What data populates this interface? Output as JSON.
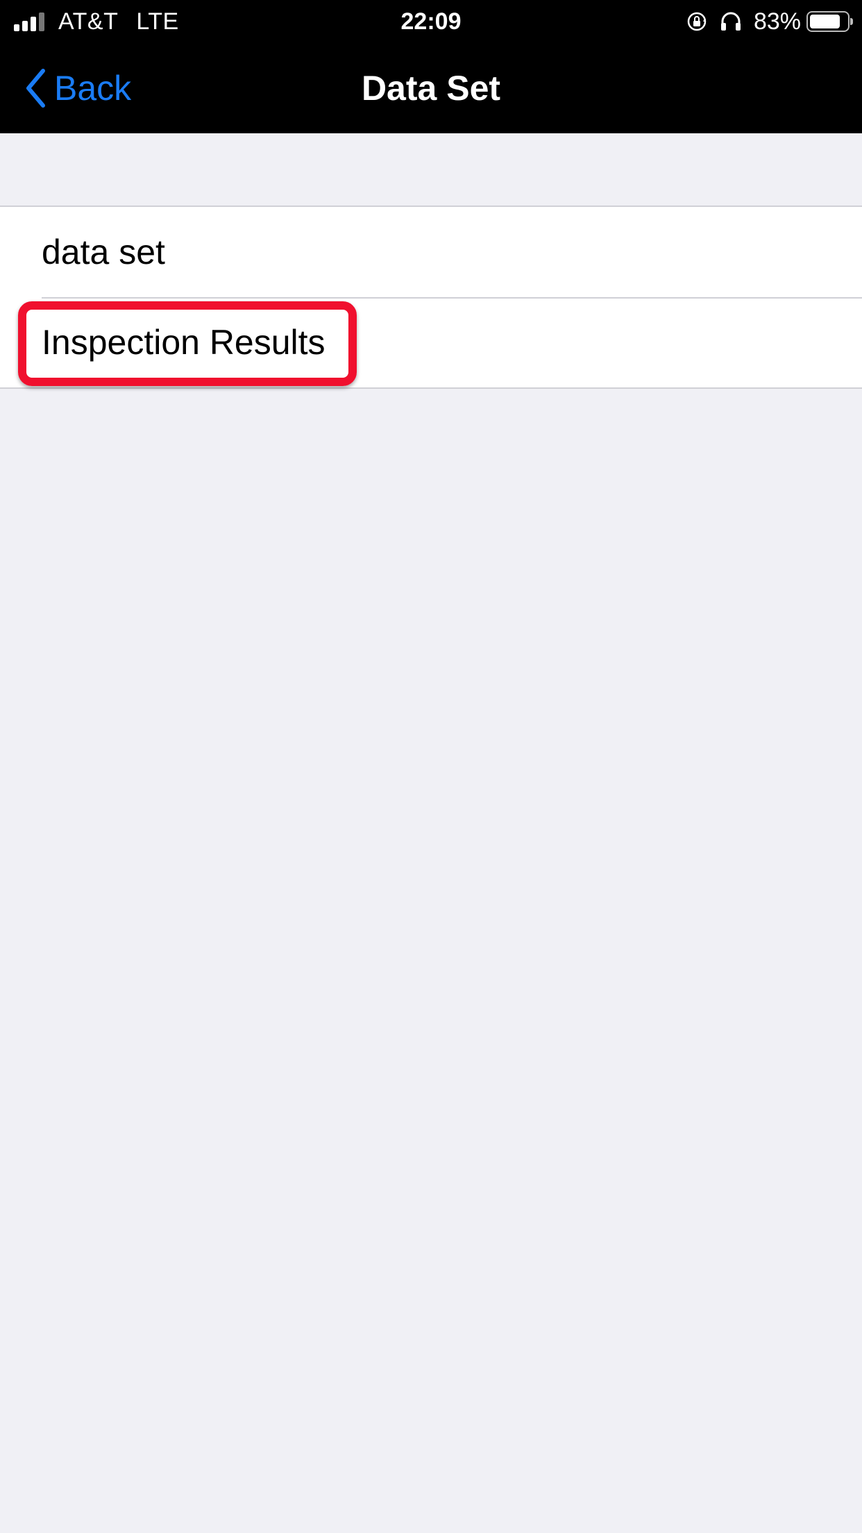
{
  "status_bar": {
    "carrier": "AT&T",
    "network": "LTE",
    "time": "22:09",
    "battery_percent_label": "83%",
    "battery_level": 0.83,
    "icons": [
      "signal-icon",
      "orientation-lock-icon",
      "headphones-icon",
      "battery-icon"
    ]
  },
  "nav": {
    "back_label": "Back",
    "title": "Data Set"
  },
  "list": {
    "items": [
      {
        "label": "data set"
      },
      {
        "label": "Inspection Results"
      }
    ]
  },
  "colors": {
    "accent": "#1a7cf5",
    "highlight": "#f0102e",
    "background": "#f0f0f5",
    "nav_background": "#000000"
  }
}
